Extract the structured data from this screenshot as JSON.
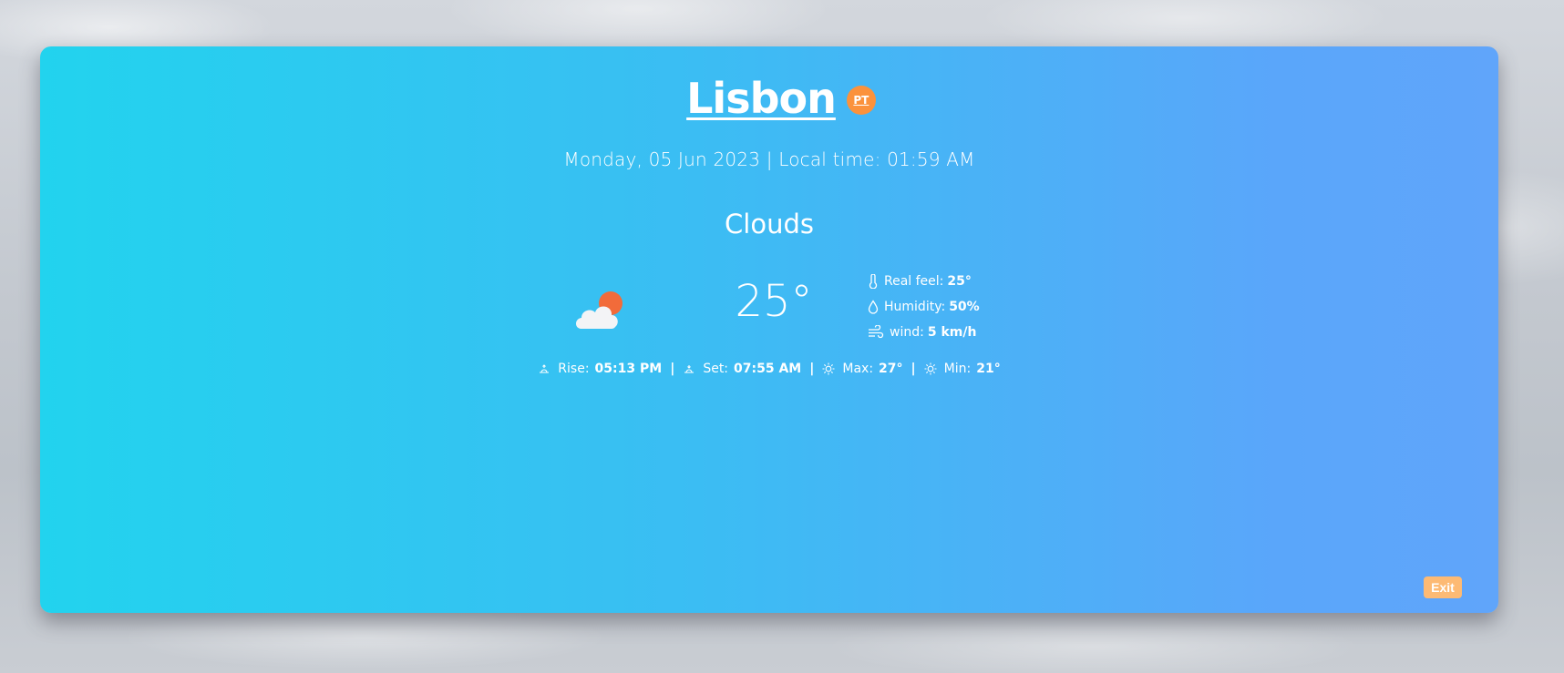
{
  "location": {
    "city": "Lisbon",
    "country_code": "PT"
  },
  "datetime_text": "Monday, 05 Jun 2023 | Local time: 01:59 AM",
  "weather": {
    "condition": "Clouds",
    "icon": "cloud-sun-icon",
    "temperature": "25°"
  },
  "details": {
    "real_feel": {
      "label": "Real feel:",
      "value": "25°"
    },
    "humidity": {
      "label": "Humidity:",
      "value": "50%"
    },
    "wind": {
      "label": "wind:",
      "value": "5 km/h"
    }
  },
  "stats": {
    "rise": {
      "label": "Rise:",
      "value": "05:13 PM"
    },
    "set": {
      "label": "Set:",
      "value": "07:55 AM"
    },
    "max": {
      "label": "Max:",
      "value": "27°"
    },
    "min": {
      "label": "Min:",
      "value": "21°"
    },
    "separator": "|"
  },
  "actions": {
    "exit_label": "Exit"
  },
  "colors": {
    "card_gradient_start": "#22d3ee",
    "card_gradient_end": "#60a5fa",
    "badge": "#fb923c",
    "exit_button": "#fdba74",
    "sun": "#f26b3a"
  }
}
